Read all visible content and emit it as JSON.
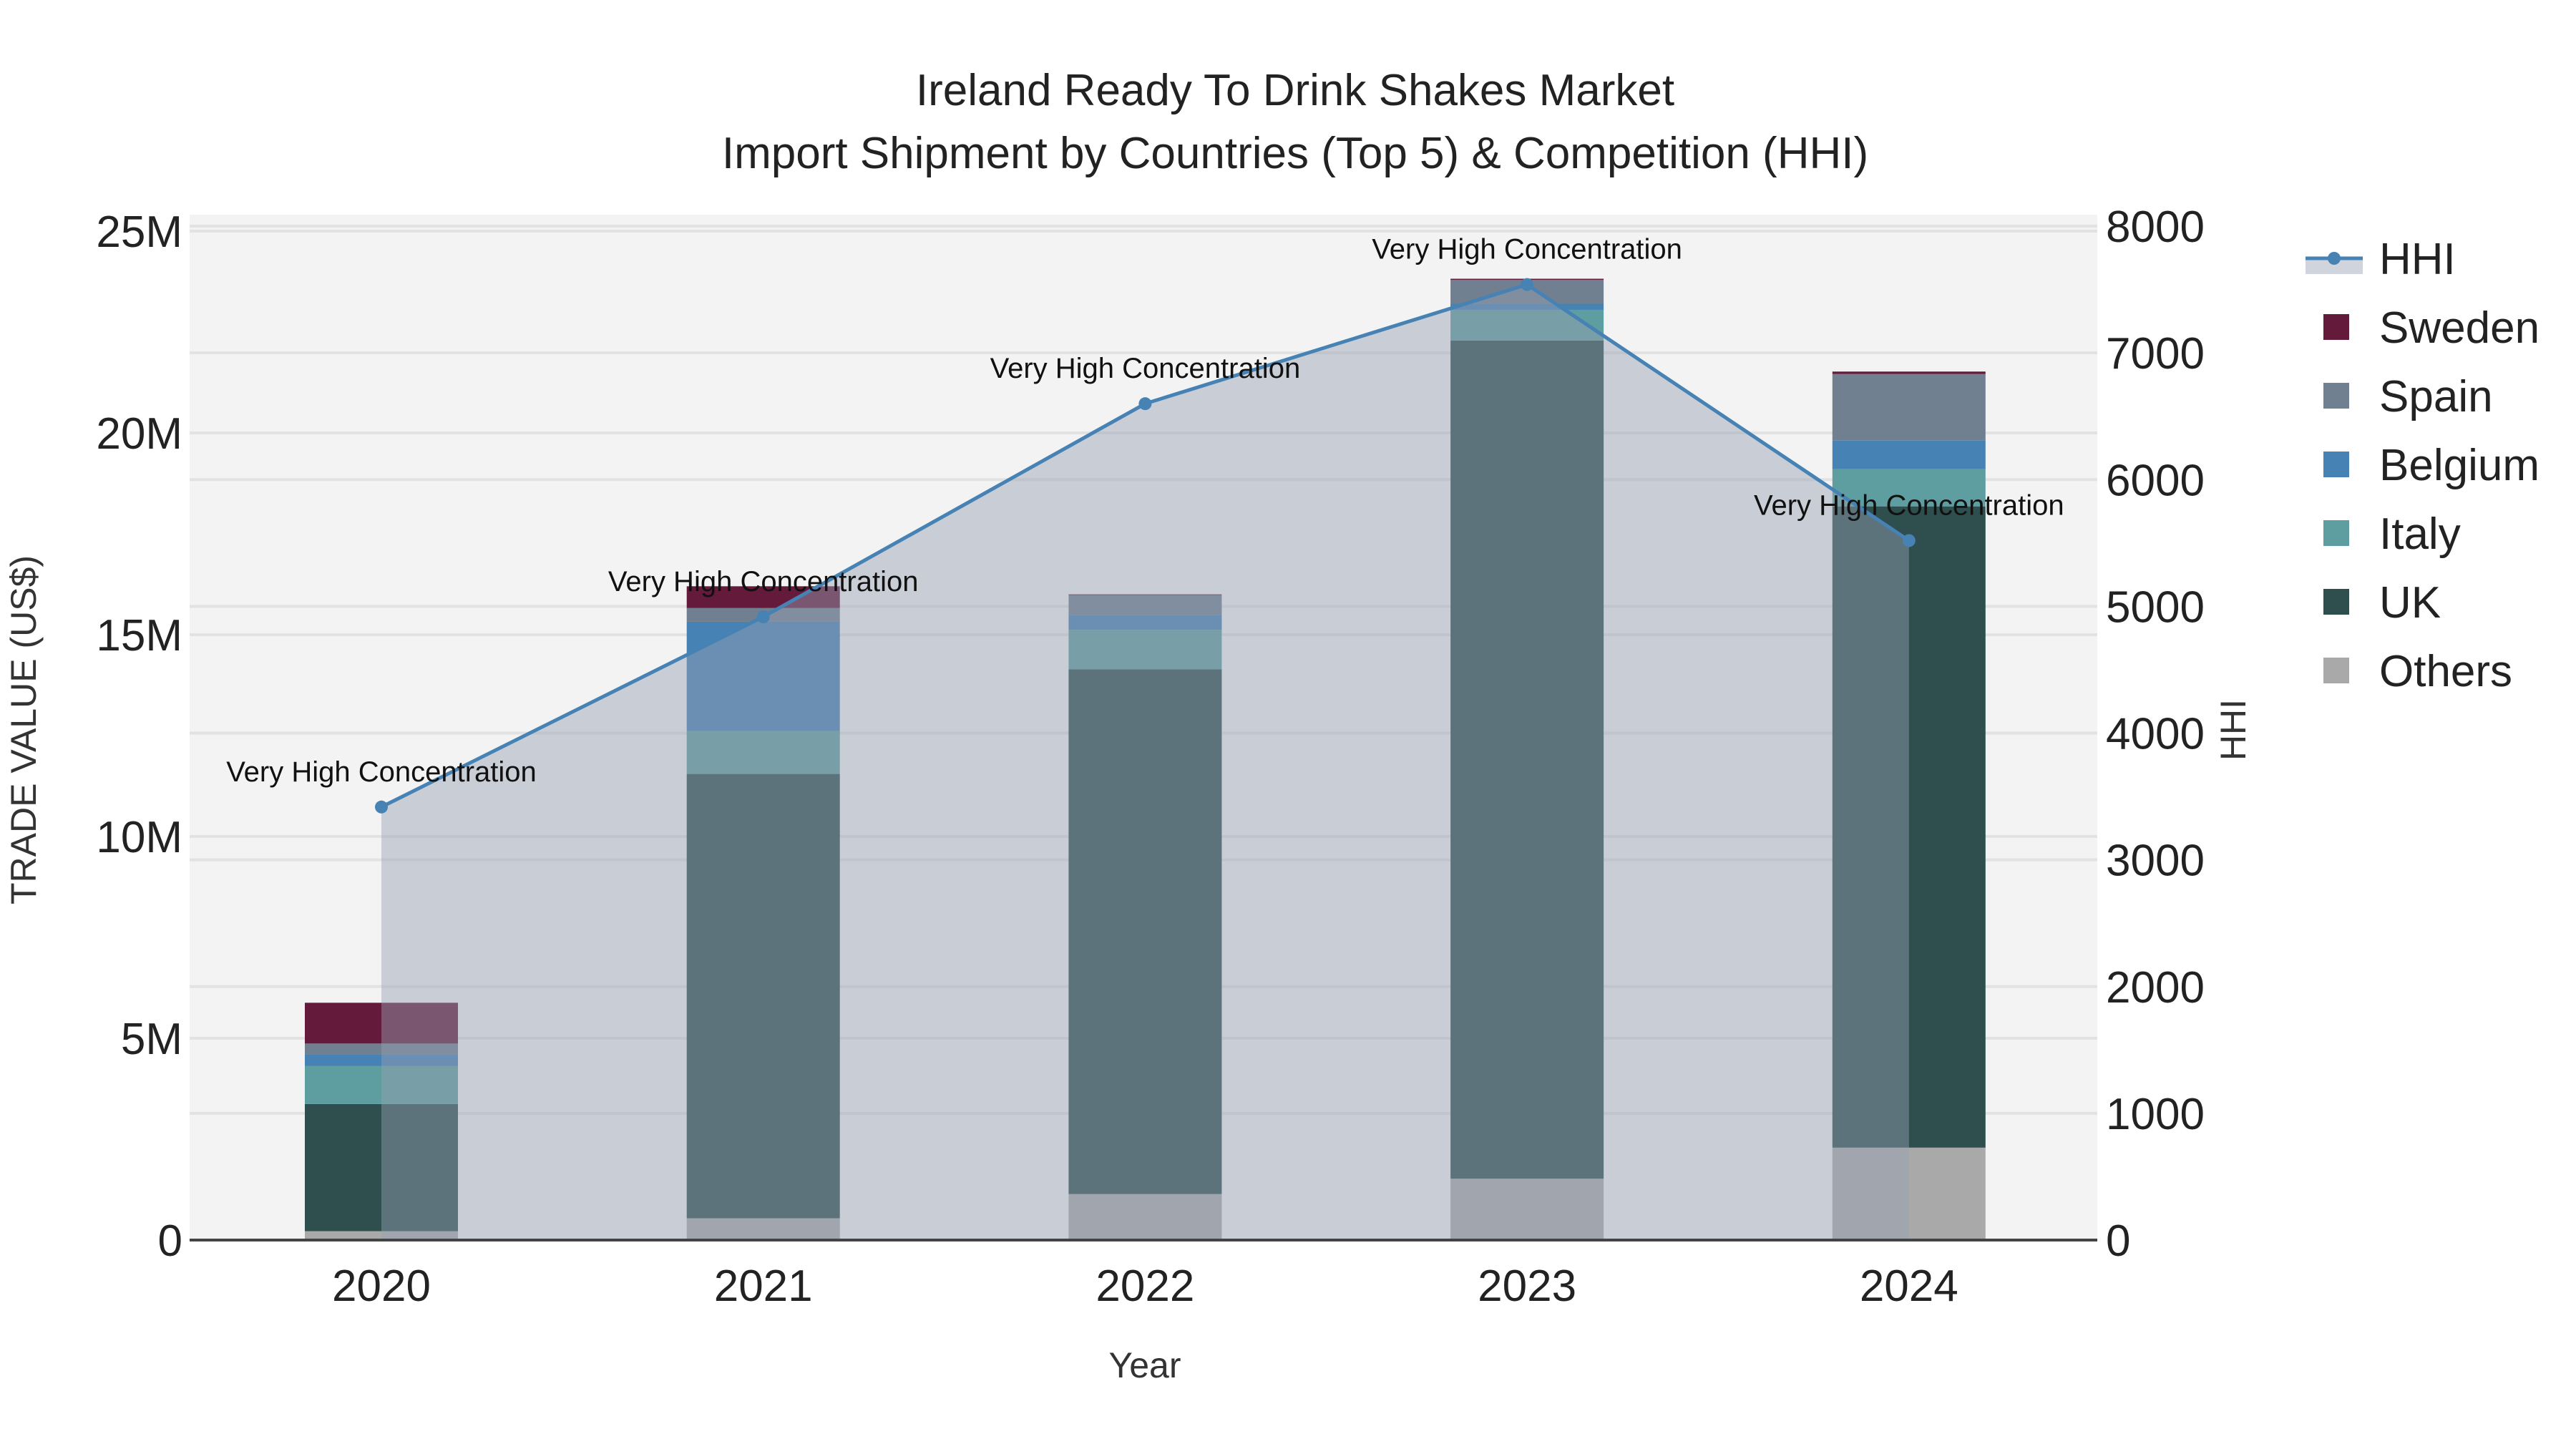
{
  "chart_data": {
    "type": "bar",
    "title": "Ireland Ready To Drink Shakes Market",
    "subtitle": "Import Shipment by Countries (Top 5) & Competition (HHI)",
    "xlabel": "Year",
    "ylabel": "TRADE VALUE (US$)",
    "y2label": "HHI",
    "categories": [
      "2020",
      "2021",
      "2022",
      "2023",
      "2024"
    ],
    "ylim": [
      0,
      25000000
    ],
    "y2lim": [
      0,
      8000
    ],
    "yticks": [
      {
        "v": 0,
        "label": "0"
      },
      {
        "v": 5000000,
        "label": "5M"
      },
      {
        "v": 10000000,
        "label": "10M"
      },
      {
        "v": 15000000,
        "label": "15M"
      },
      {
        "v": 20000000,
        "label": "20M"
      },
      {
        "v": 25000000,
        "label": "25M"
      }
    ],
    "y2ticks": [
      0,
      1000,
      2000,
      3000,
      4000,
      5000,
      6000,
      7000,
      8000
    ],
    "stack_order": "bottom-to-top",
    "series": [
      {
        "name": "Others",
        "color": "#a9a9a9",
        "values": [
          220000,
          540000,
          1140000,
          1520000,
          2290000
        ]
      },
      {
        "name": "UK",
        "color": "#2f4f4f",
        "values": [
          3150000,
          11010000,
          13000000,
          20770000,
          15890000
        ]
      },
      {
        "name": "Italy",
        "color": "#5f9ea0",
        "values": [
          940000,
          1060000,
          980000,
          760000,
          920000
        ]
      },
      {
        "name": "Belgium",
        "color": "#4682b4",
        "values": [
          290000,
          2710000,
          370000,
          150000,
          710000
        ]
      },
      {
        "name": "Spain",
        "color": "#708090",
        "values": [
          270000,
          340000,
          490000,
          590000,
          1650000
        ]
      },
      {
        "name": "Sweden",
        "color": "#641a3b",
        "values": [
          1010000,
          540000,
          20000,
          30000,
          60000
        ]
      }
    ],
    "hhi": {
      "name": "HHI",
      "color": "#4682b4",
      "values": [
        3417,
        4917,
        6599,
        7539,
        5519
      ],
      "annotations": [
        "Very High Concentration",
        "Very High Concentration",
        "Very High Concentration",
        "Very High Concentration",
        "Very High Concentration"
      ]
    },
    "legend": [
      "HHI",
      "Sweden",
      "Spain",
      "Belgium",
      "Italy",
      "UK",
      "Others"
    ],
    "legend_placement": "right",
    "grid": true
  }
}
